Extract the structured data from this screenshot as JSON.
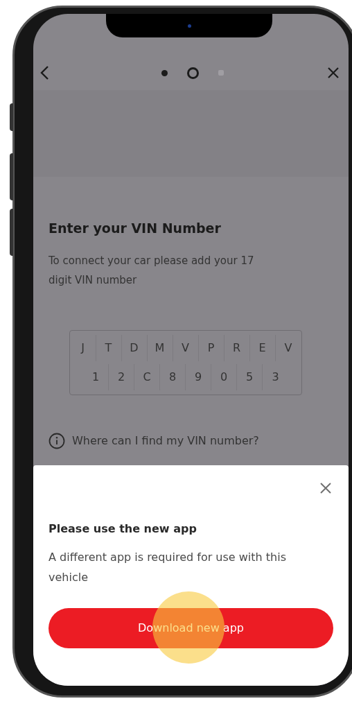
{
  "nav": {
    "steps": [
      {
        "completed": true,
        "selected": false
      },
      {
        "completed": false,
        "selected": true
      },
      {
        "completed": false,
        "selected": false
      }
    ]
  },
  "vin": {
    "title": "Enter your VIN Number",
    "description": "To connect your car please add your 17 digit VIN number",
    "rows": [
      [
        "J",
        "T",
        "D",
        "M",
        "V",
        "P",
        "R",
        "E",
        "V"
      ],
      [
        "1",
        "2",
        "C",
        "8",
        "9",
        "0",
        "5",
        "3"
      ]
    ],
    "help_link": "Where can I find my VIN number?"
  },
  "sheet": {
    "title": "Please use the new app",
    "message": "A different app is required for use with this vehicle",
    "button": {
      "label": "Download new app",
      "touch_indicator": true
    }
  }
}
